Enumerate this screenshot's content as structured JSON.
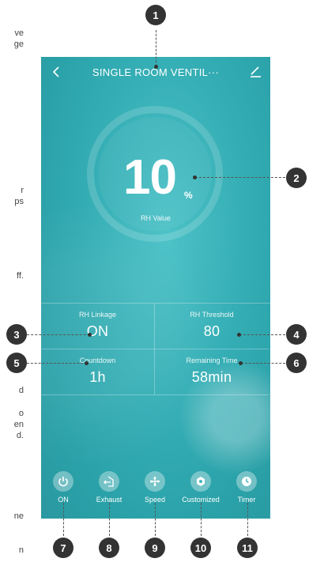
{
  "app": {
    "title": "SINGLE ROOM VENTIL···"
  },
  "rh": {
    "value": "10",
    "unit": "%",
    "label": "RH Value"
  },
  "grid": [
    {
      "label": "RH Linkage",
      "value": "ON"
    },
    {
      "label": "RH Threshold",
      "value": "80"
    },
    {
      "label": "Countdown",
      "value": "1h"
    },
    {
      "label": "Remaining Time",
      "value": "58min"
    }
  ],
  "buttons": [
    {
      "label": "ON",
      "icon": "power-icon"
    },
    {
      "label": "Exhaust",
      "icon": "exhaust-icon"
    },
    {
      "label": "Speed",
      "icon": "fan-icon"
    },
    {
      "label": "Customized",
      "icon": "hexagon-icon"
    },
    {
      "label": "Timer",
      "icon": "clock-icon"
    }
  ],
  "callouts": [
    "1",
    "2",
    "3",
    "4",
    "5",
    "6",
    "7",
    "8",
    "9",
    "10",
    "11"
  ],
  "side_text_left": [
    "ve",
    "ge",
    "r",
    "ps",
    "ff.",
    "d",
    "o",
    "en",
    "d.",
    "ne",
    "n"
  ],
  "colors": {
    "teal": "#34adb4",
    "badge": "#333333"
  }
}
